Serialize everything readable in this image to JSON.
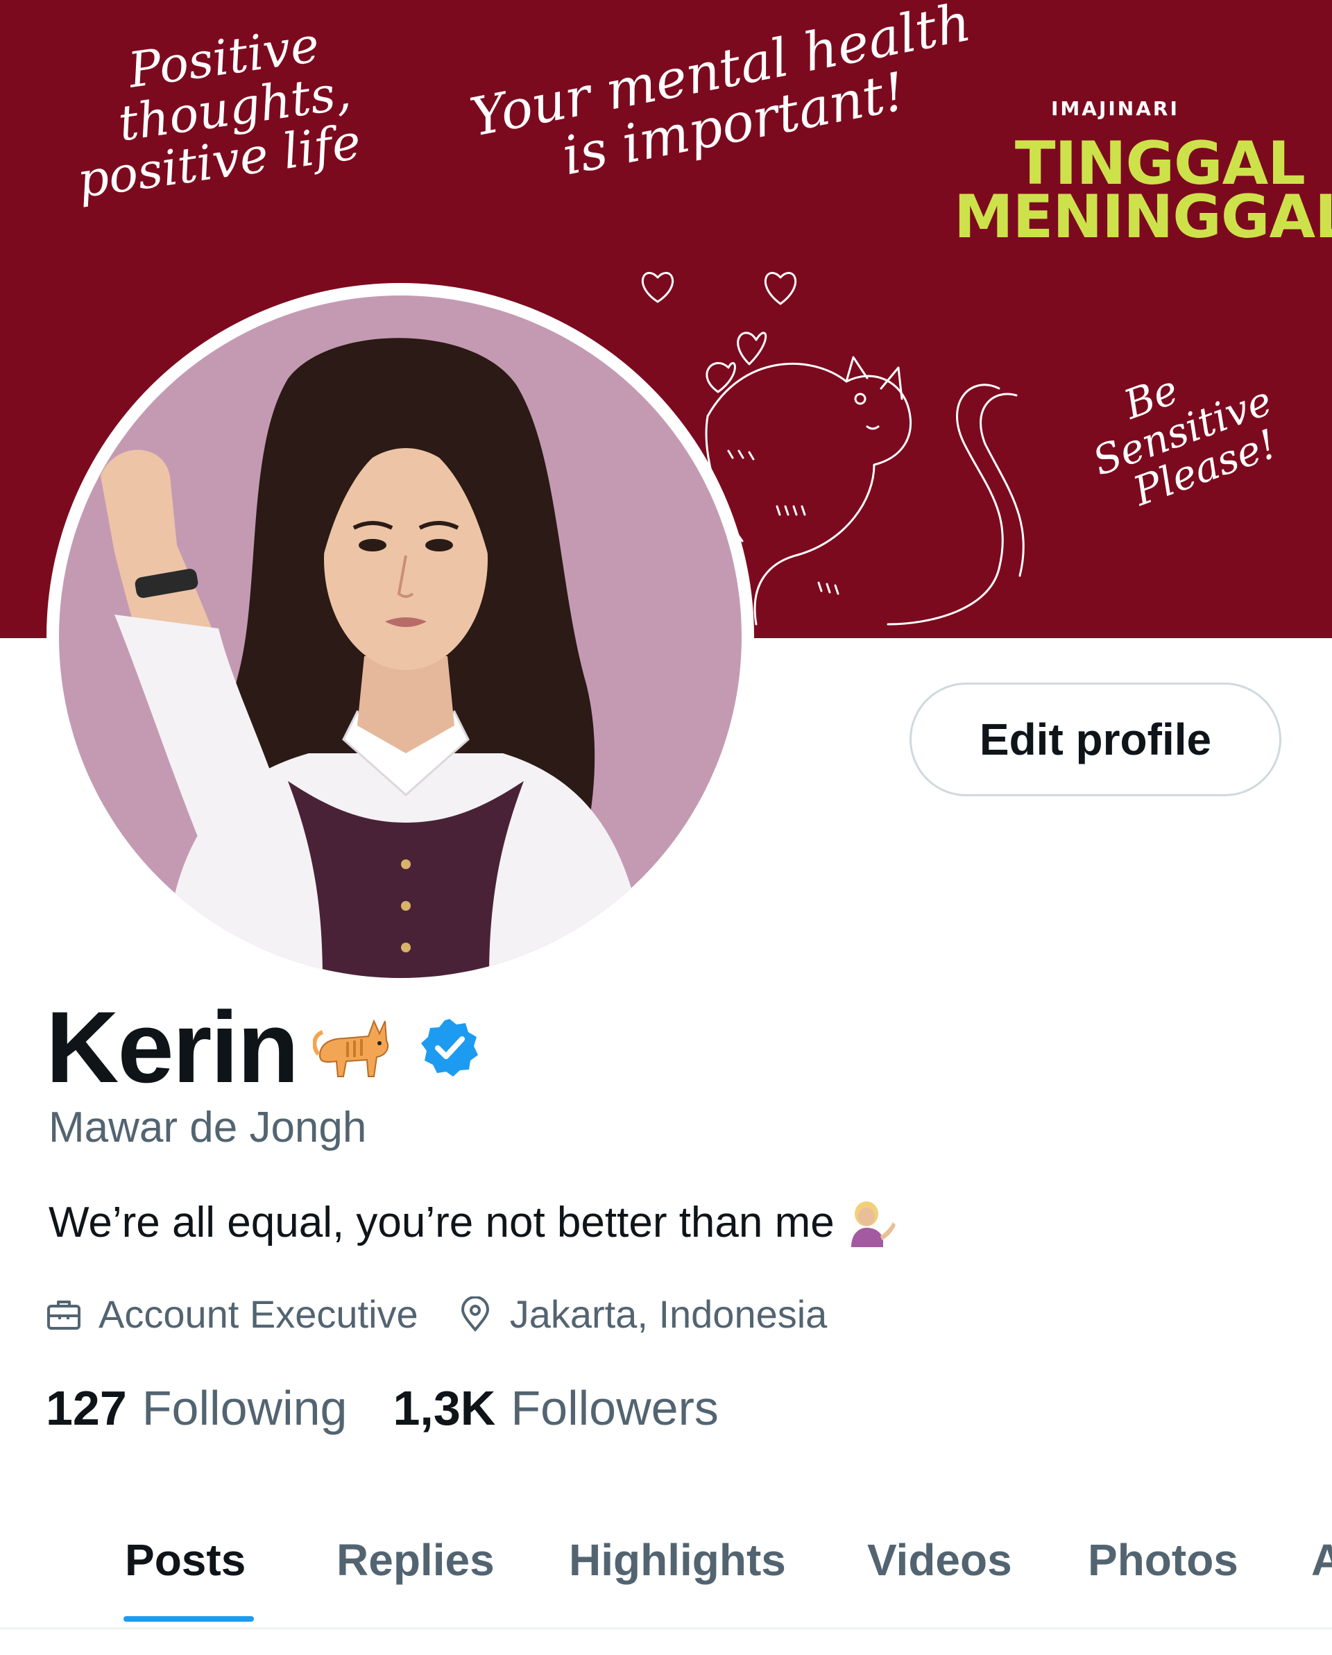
{
  "banner": {
    "quote_left": [
      "Positive",
      "thoughts,",
      "positive life"
    ],
    "quote_center": [
      "Your mental health",
      "is important!"
    ],
    "quote_right": [
      "Be",
      "Sensitive",
      "Please!"
    ],
    "studio": "IMAJINARI",
    "movie_title": [
      "TINGGAL",
      "MENINGGAL"
    ],
    "colors": {
      "background": "#7c0a1e",
      "title": "#cde24a"
    }
  },
  "profile": {
    "display_name": "Kerin",
    "name_emoji": "cat-emoji",
    "verified_icon": "verified-badge-icon",
    "handle": "Mawar de Jongh",
    "bio": "We’re all equal, you’re not better than me",
    "bio_emoji": "person-tipping-hand-emoji",
    "occupation": "Account Executive",
    "location": "Jakarta, Indonesia",
    "following_count": "127",
    "following_label": "Following",
    "followers_count": "1,3K",
    "followers_label": "Followers"
  },
  "actions": {
    "edit_profile": "Edit profile"
  },
  "tabs": [
    {
      "label": "Posts",
      "active": true
    },
    {
      "label": "Replies",
      "active": false
    },
    {
      "label": "Highlights",
      "active": false
    },
    {
      "label": "Videos",
      "active": false
    },
    {
      "label": "Photos",
      "active": false
    },
    {
      "label": "A",
      "active": false
    }
  ],
  "colors": {
    "accent": "#1d9bf0",
    "text": "#0f1419",
    "muted": "#536471",
    "border": "#cfd9de"
  }
}
